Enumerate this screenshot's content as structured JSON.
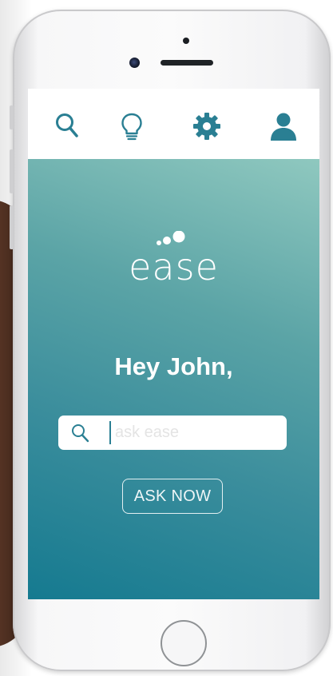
{
  "topbar": {
    "icons": [
      "search-icon",
      "lightbulb-icon",
      "gear-icon",
      "user-icon"
    ]
  },
  "colors": {
    "accent": "#2a7f93",
    "gradient_top": "#8fc8bf",
    "gradient_bottom": "#157a90"
  },
  "brand": {
    "logo_text": "ease"
  },
  "main": {
    "greeting": "Hey John,",
    "search": {
      "placeholder": "ask ease",
      "value": ""
    },
    "ask_button_label": "ASK NOW"
  }
}
